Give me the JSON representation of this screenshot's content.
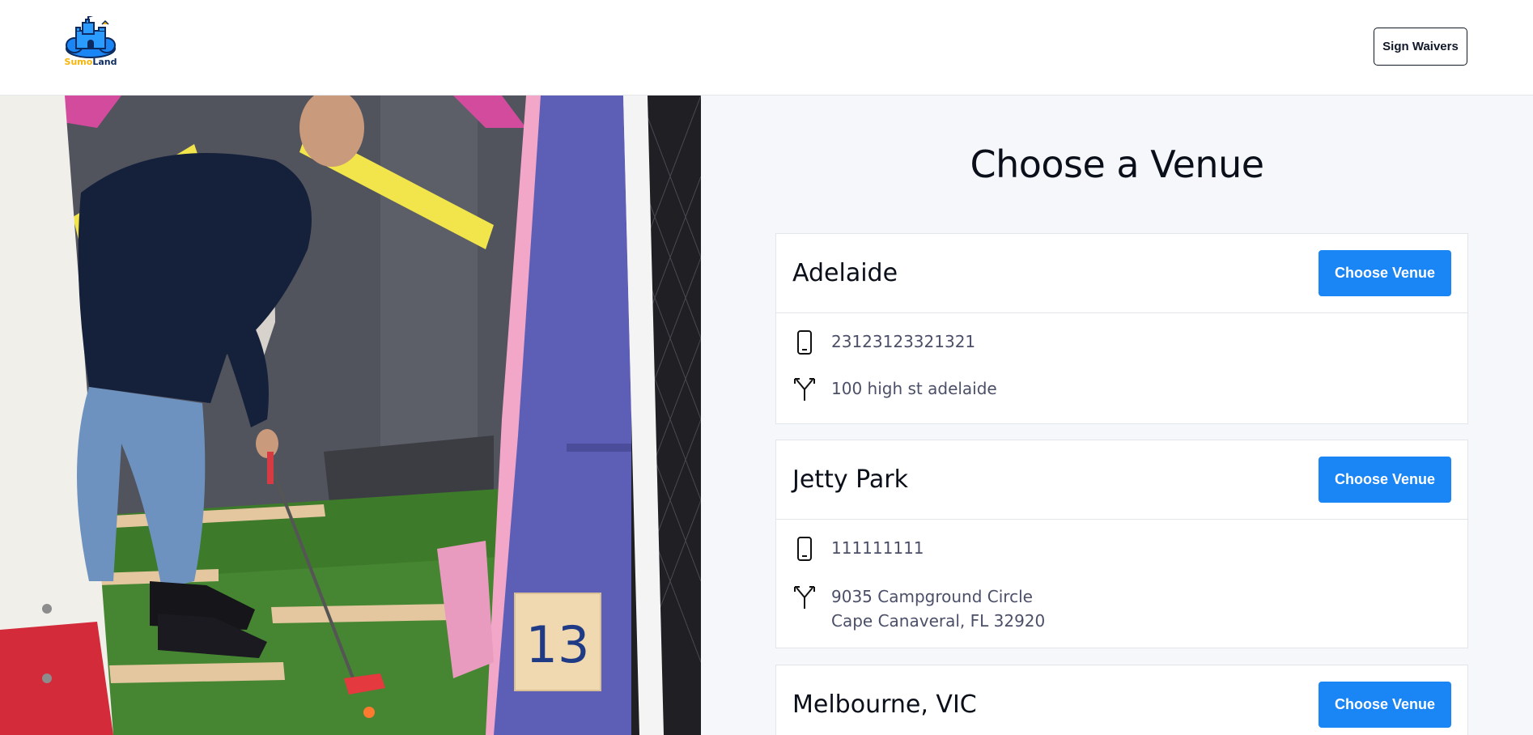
{
  "brand": {
    "logo_word_1": "Sumo",
    "logo_word_2": "Land",
    "colors": {
      "accent": "#1a85f5",
      "logo_yellow": "#f5b50a",
      "logo_navy": "#0d2a5e"
    }
  },
  "header": {
    "sign_waivers_label": "Sign Waivers"
  },
  "main": {
    "title": "Choose a Venue",
    "choose_label": "Choose Venue",
    "venues": [
      {
        "name": "Adelaide",
        "phone": "23123123321321",
        "address_line_1": "100 high st adelaide",
        "address_line_2": ""
      },
      {
        "name": "Jetty Park",
        "phone": "111111111",
        "address_line_1": "9035 Campground Circle",
        "address_line_2": "Cape Canaveral, FL 32920"
      },
      {
        "name": "Melbourne, VIC"
      }
    ]
  },
  "photo": {
    "hole_number": "13",
    "icons": [
      "phone-icon",
      "directions-icon"
    ]
  }
}
